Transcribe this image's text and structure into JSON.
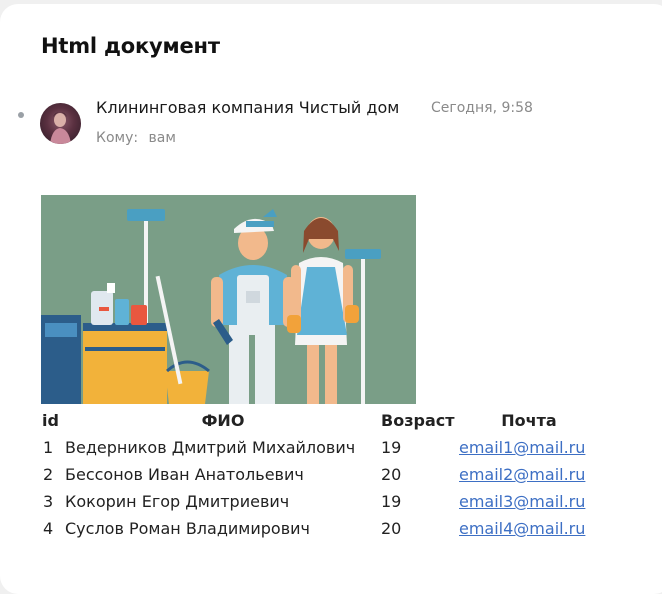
{
  "email": {
    "subject": "Html документ",
    "sender": "Клининговая компания Чистый дом",
    "date": "Сегодня, 9:58",
    "to_label": "Кому:",
    "to_value": "вам"
  },
  "table": {
    "headers": [
      "id",
      "ФИО",
      "Возраст",
      "Почта"
    ],
    "rows": [
      {
        "id": "1",
        "fio": "Ведерников Дмитрий Михайлович",
        "age": "19",
        "email": "email1@mail.ru"
      },
      {
        "id": "2",
        "fio": "Бессонов Иван Анатольевич",
        "age": "20",
        "email": "email2@mail.ru"
      },
      {
        "id": "3",
        "fio": "Кокорин Егор Дмитриевич",
        "age": "19",
        "email": "email3@mail.ru"
      },
      {
        "id": "4",
        "fio": "Суслов Роман Владимирович",
        "age": "20",
        "email": "email4@mail.ru"
      }
    ]
  },
  "colors": {
    "banner_bg": "#7a9e87",
    "link": "#3d6fc4",
    "muted": "#8a8a8a"
  },
  "icons": [
    "unread-dot-icon",
    "avatar",
    "cleaners-illustration"
  ]
}
